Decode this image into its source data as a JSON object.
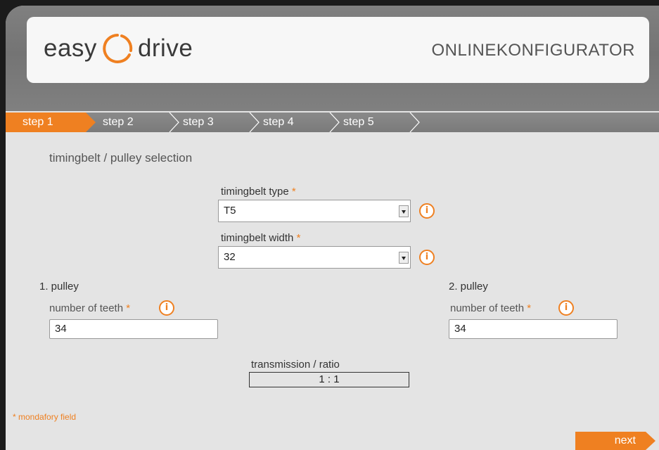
{
  "brand": {
    "logo_left": "easy",
    "logo_right": "drive",
    "header_right": "ONLINEKONFIGURATOR"
  },
  "steps": [
    {
      "label": "step 1",
      "active": true
    },
    {
      "label": "step 2",
      "active": false
    },
    {
      "label": "step 3",
      "active": false
    },
    {
      "label": "step 4",
      "active": false
    },
    {
      "label": "step 5",
      "active": false
    }
  ],
  "section_title": "timingbelt / pulley selection",
  "belt_type": {
    "label": "timingbelt type",
    "required_mark": "*",
    "value": "T5"
  },
  "belt_width": {
    "label": "timingbelt width",
    "required_mark": "*",
    "value": "32"
  },
  "pulley1": {
    "title": "1. pulley",
    "teeth_label": "number of teeth",
    "required_mark": "*",
    "value": "34"
  },
  "pulley2": {
    "title": "2. pulley",
    "teeth_label": "number of teeth",
    "required_mark": "*",
    "value": "34"
  },
  "ratio": {
    "label": "transmission / ratio",
    "value": "1 : 1"
  },
  "mandatory_note": "* mondafory field",
  "next_label": "next",
  "info_glyph": "i",
  "colors": {
    "accent": "#ef8021",
    "band": "#7d7d7d",
    "panel": "#e4e4e4"
  }
}
